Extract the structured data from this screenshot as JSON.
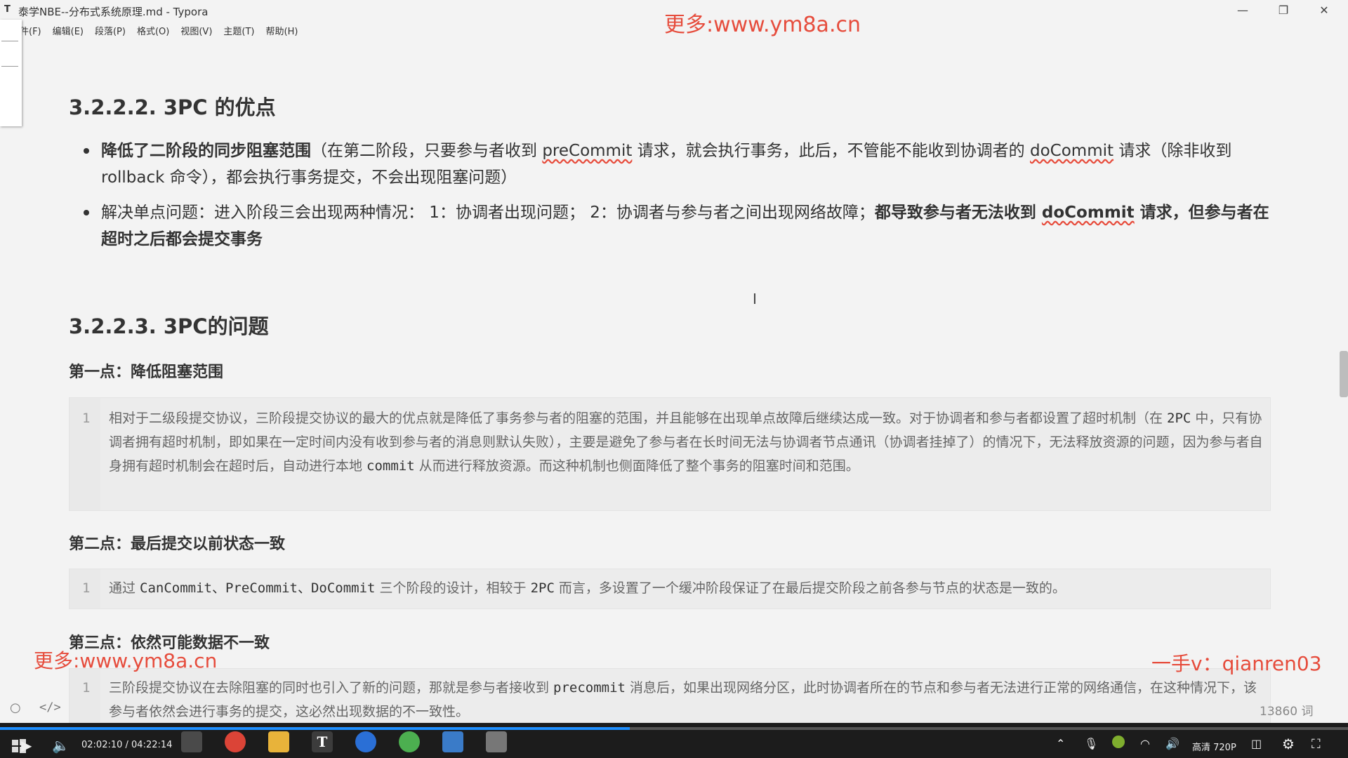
{
  "window": {
    "app_icon": "T",
    "title": "泰学NBE--分布式系统原理.md - Typora",
    "buttons": {
      "minimize": "—",
      "maximize": "❐",
      "close": "✕"
    }
  },
  "menubar": [
    "件(F)",
    "编辑(E)",
    "段落(P)",
    "格式(O)",
    "视图(V)",
    "主题(T)",
    "帮助(H)"
  ],
  "watermarks": {
    "top": "更多:www.ym8a.cn",
    "bottom_left": "更多:www.ym8a.cn",
    "bottom_right": "一手v：qianren03"
  },
  "content": {
    "section1_heading": "3.2.2.2. 3PC 的优点",
    "bullet1": {
      "bold": "降低了二阶段的同步阻塞范围",
      "t1": "（在第二阶段，只要参与者收到 ",
      "c1": "preCommit",
      "t2": " 请求，就会执行事务，此后，不管能不能收到协调者的 ",
      "c2": "doCommit",
      "t3": " 请求（除非收到 rollback 命令），都会执行事务提交，不会出现阻塞问题）"
    },
    "bullet2": {
      "t1": "解决单点问题：进入阶段三会出现两种情况： 1：协调者出现问题； 2：协调者与参与者之间出现网络故障；",
      "b1": "都导致参与者无法收到 ",
      "c1": "doCommit",
      "b2": " 请求，但参与者在超时之后都会提交事务"
    },
    "section2_heading": "3.2.2.3. 3PC的问题",
    "point1_heading": "第一点：降低阻塞范围",
    "code1": {
      "line_no": "1",
      "t1": "相对于二级段提交协议，三阶段提交协议的最大的优点就是降低了事务参与者的阻塞的范围，并且能够在出现单点故障后继续达成一致。对于协调者和参与者都设置了超时机制（在 ",
      "m1": "2PC",
      "t2": " 中，只有协调者拥有超时机制，即如果在一定时间内没有收到参与者的消息则默认失败），主要是避免了参与者在长时间无法与协调者节点通讯（协调者挂掉了）的情况下，无法释放资源的问题，因为参与者自身拥有超时机制会在超时后，自动进行本地 ",
      "m2": "commit",
      "t3": " 从而进行释放资源。而这种机制也侧面降低了整个事务的阻塞时间和范围。"
    },
    "point2_heading": "第二点：最后提交以前状态一致",
    "code2": {
      "line_no": "1",
      "t1": "通过 ",
      "m1": "CanCommit、PreCommit、DoCommit",
      "t2": " 三个阶段的设计，相较于 ",
      "m2": "2PC",
      "t3": " 而言，多设置了一个缓冲阶段保证了在最后提交阶段之前各参与节点的状态是一致的。"
    },
    "point3_heading": "第三点：依然可能数据不一致",
    "code3": {
      "line_no": "1",
      "t1": "三阶段提交协议在去除阻塞的同时也引入了新的问题，那就是参与者接收到 ",
      "m1": "precommit",
      "t2": " 消息后，如果出现网络分区，此时协调者所在的节点和参与者无法进行正常的网络通信，在这种情况下，该参与者依然会进行事务的提交，这必然出现数据的不一致性。"
    }
  },
  "statusbar": {
    "left_icon": "circle-icon",
    "code_toggle": "</>",
    "word_count": "13860 词"
  },
  "player": {
    "time": "02:02:10 / 04:22:14",
    "progress": 0.467,
    "quality": "高清 720P",
    "taskbar_icon_colors": [
      "#4a4a4a",
      "#db4437",
      "#e8b33a",
      "#3c3c3c",
      "#2a6fd6",
      "#4caf50",
      "#3a7bc8",
      "#777777"
    ]
  },
  "colors": {
    "accent_red": "#e64c3c",
    "progress_blue": "#1e8fff"
  }
}
